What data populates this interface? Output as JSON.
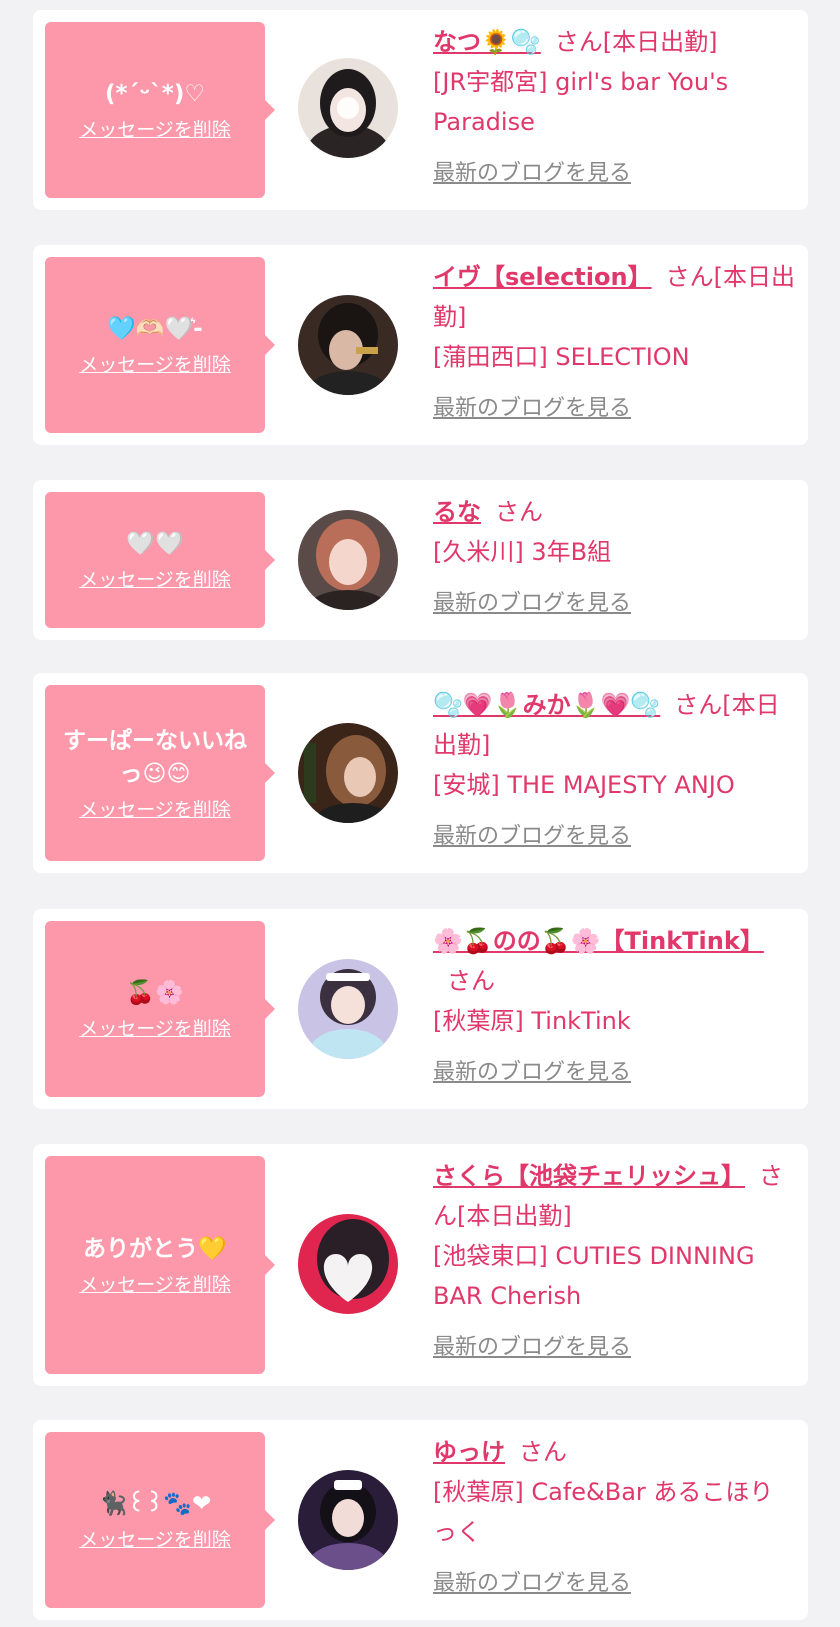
{
  "colors": {
    "background": "#f2f2f4",
    "card": "#ffffff",
    "bubble": "#fc98aa",
    "accent": "#e0386b",
    "link_gray": "#8a8a8a"
  },
  "items": [
    {
      "message": "(*ˊᵕˋ*)♡",
      "delete_label": "メッセージを削除",
      "name": "なつ🌻🫧",
      "san": "さん[本日出勤]",
      "shop": "[JR宇都宮] girl's bar You's Paradise",
      "blog_label": "最新のブログを見る",
      "avatar_icon": "avatar-photo"
    },
    {
      "message": "🩵🫶🏻🤍͛-",
      "delete_label": "メッセージを削除",
      "name": "イヴ【selection】",
      "san": "さん[本日出勤]",
      "shop": "[蒲田西口] SELECTION",
      "blog_label": "最新のブログを見る",
      "avatar_icon": "avatar-photo"
    },
    {
      "message": "🤍🤍",
      "delete_label": "メッセージを削除",
      "name": "るな",
      "san": "さん",
      "shop": "[久米川] 3年B組",
      "blog_label": "最新のブログを見る",
      "avatar_icon": "avatar-photo"
    },
    {
      "message": "すーぱーないいねっ😉😊",
      "delete_label": "メッセージを削除",
      "name": "🫧💗🌷みか🌷💗🫧",
      "san": "さん[本日出勤]",
      "shop": "[安城] THE MAJESTY ANJO",
      "blog_label": "最新のブログを見る",
      "avatar_icon": "avatar-photo"
    },
    {
      "message": "🍒🌸",
      "delete_label": "メッセージを削除",
      "name": "🌸🍒のの🍒🌸【TinkTink】",
      "san": "さん",
      "shop": "[秋葉原] TinkTink",
      "blog_label": "最新のブログを見る",
      "avatar_icon": "avatar-photo"
    },
    {
      "message": "ありがとう💛",
      "delete_label": "メッセージを削除",
      "name": "さくら【池袋チェリッシュ】",
      "san": "さん[本日出勤]",
      "shop": "[池袋東口] CUTIES DINNING BAR Cherish",
      "blog_label": "最新のブログを見る",
      "avatar_icon": "avatar-photo-heart"
    },
    {
      "message": "🐈‍⬛꒰꒱🐾❤",
      "delete_label": "メッセージを削除",
      "name": "ゆっけ",
      "san": "さん",
      "shop": "[秋葉原] Cafe&Bar あるこほりっく",
      "blog_label": "最新のブログを見る",
      "avatar_icon": "avatar-photo"
    }
  ]
}
